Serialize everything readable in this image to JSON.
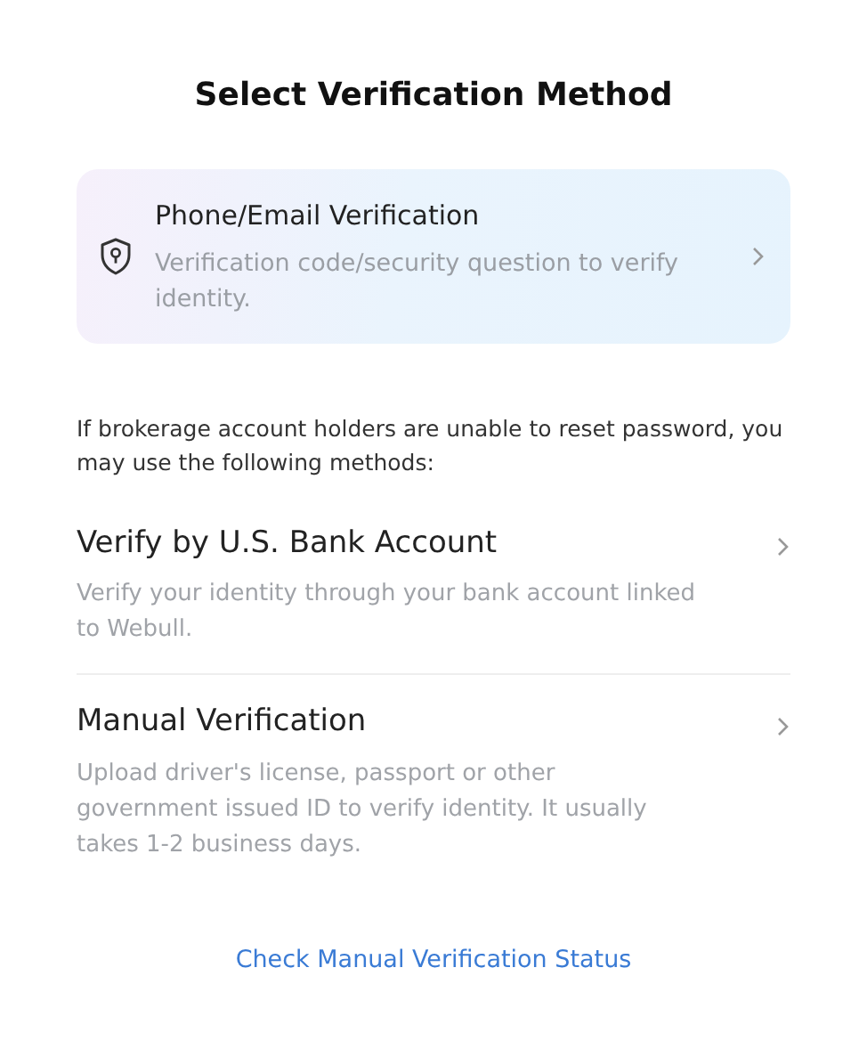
{
  "title": "Select Verification Method",
  "primary_option": {
    "title": "Phone/Email Verification",
    "description": "Verification code/security question to verify identity."
  },
  "note": "If brokerage account holders are unable to reset password, you may use the following methods:",
  "methods": [
    {
      "title": "Verify by U.S. Bank Account",
      "description": "Verify your identity through your bank account linked to Webull."
    },
    {
      "title": "Manual Verification",
      "description": "Upload driver's license, passport or other government issued ID to verify identity. It usually takes 1-2 business days."
    }
  ],
  "status_link": "Check Manual Verification Status"
}
